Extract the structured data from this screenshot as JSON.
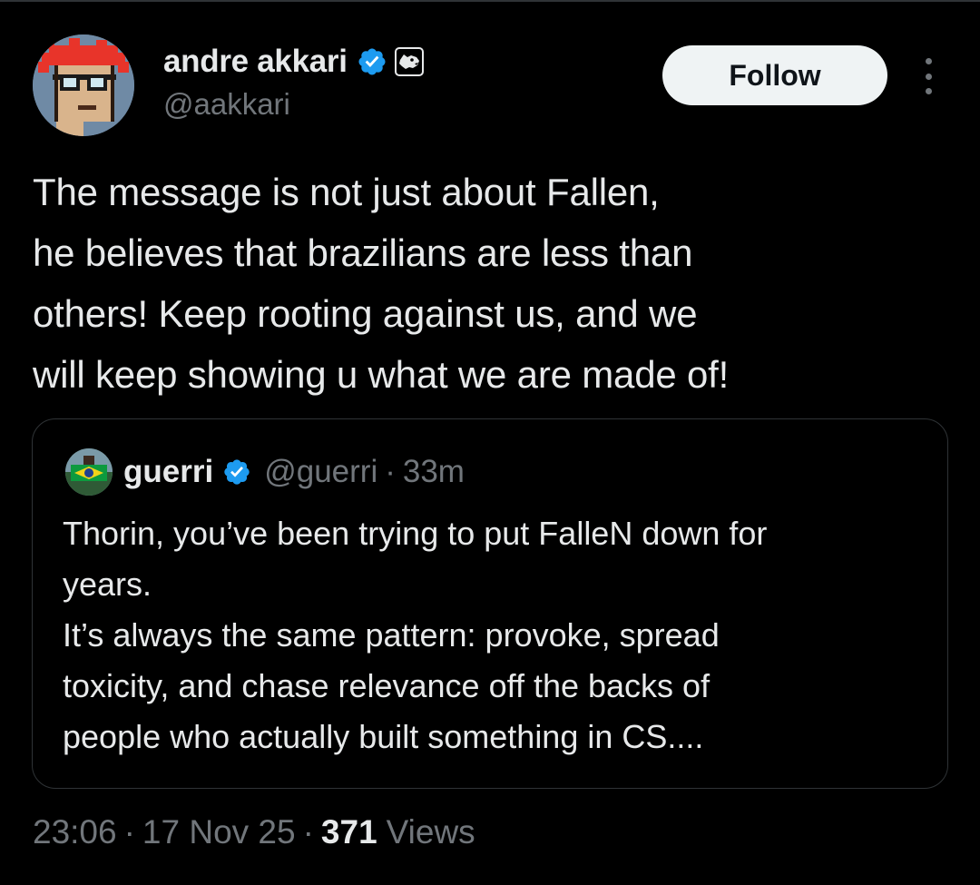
{
  "author": {
    "display_name": "andre akkari",
    "handle": "@aakkari",
    "avatar_icon": "pixel-punk-avatar-icon",
    "verified_icon": "verified-badge-icon",
    "org_icon": "panther-org-badge-icon"
  },
  "actions": {
    "follow_label": "Follow",
    "more_icon": "more-options-icon"
  },
  "tweet": {
    "text": "The message is not just about Fallen,\nhe believes that brazilians are less than\nothers! Keep rooting against us, and we\nwill keep showing u what we are made of!"
  },
  "quote": {
    "display_name": "guerri",
    "handle": "@guerri",
    "separator": "·",
    "time": "33m",
    "text": "Thorin, you’ve been trying to put FalleN down for\nyears.\nIt’s always the same pattern: provoke, spread\ntoxicity, and chase relevance off the backs of\npeople who actually built something in CS...."
  },
  "meta": {
    "time": "23:06",
    "separator": "·",
    "date": "17 Nov 25",
    "views_count": "371",
    "views_label": "Views"
  },
  "colors": {
    "background": "#000000",
    "text_primary": "#e7e9ea",
    "text_secondary": "#71767b",
    "border": "#2f3336",
    "verified_blue": "#1d9bf0",
    "follow_bg": "#eff3f4"
  }
}
